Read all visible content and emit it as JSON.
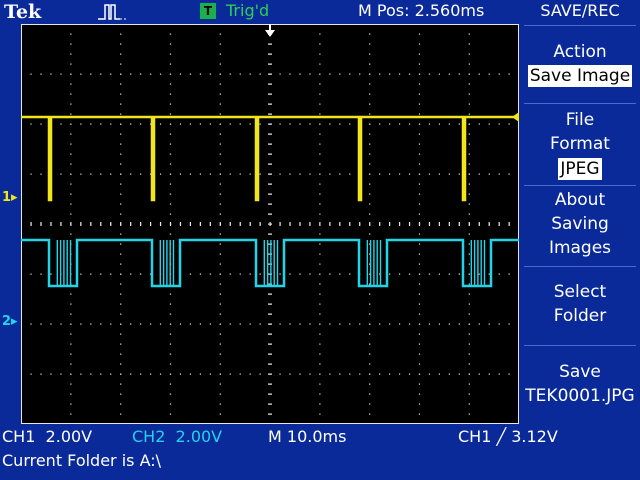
{
  "header": {
    "brand": "Tek",
    "acquisition_icon": "run-pulse-icon",
    "trigger_badge": "T",
    "trigger_status": "Trig'd",
    "horizontal_position": "M Pos: 2.560ms"
  },
  "channel_markers": {
    "ch1": "1",
    "ch2": "2"
  },
  "menu": {
    "title": "SAVE/REC",
    "items": [
      {
        "label": "Action",
        "value": "Save Image"
      },
      {
        "label_lines": [
          "File",
          "Format"
        ],
        "value": "JPEG"
      },
      {
        "label_lines": [
          "About",
          "Saving",
          "Images"
        ]
      },
      {
        "label_lines": [
          "Select",
          "Folder"
        ]
      },
      {
        "label_lines": [
          "Save",
          "TEK0001.JPG"
        ]
      }
    ]
  },
  "status": {
    "ch1": "CH1  2.00V",
    "ch2": "CH2  2.00V",
    "timebase": "M 10.0ms",
    "trigger": "CH1 ╱ 3.12V",
    "folder": "Current Folder is A:\\"
  },
  "colors": {
    "ch1": "#f2e51a",
    "ch2": "#22d4e8",
    "background": "#0a2a9a",
    "graticule": "#e6e6e6",
    "trigger": "#1ab04a"
  }
}
